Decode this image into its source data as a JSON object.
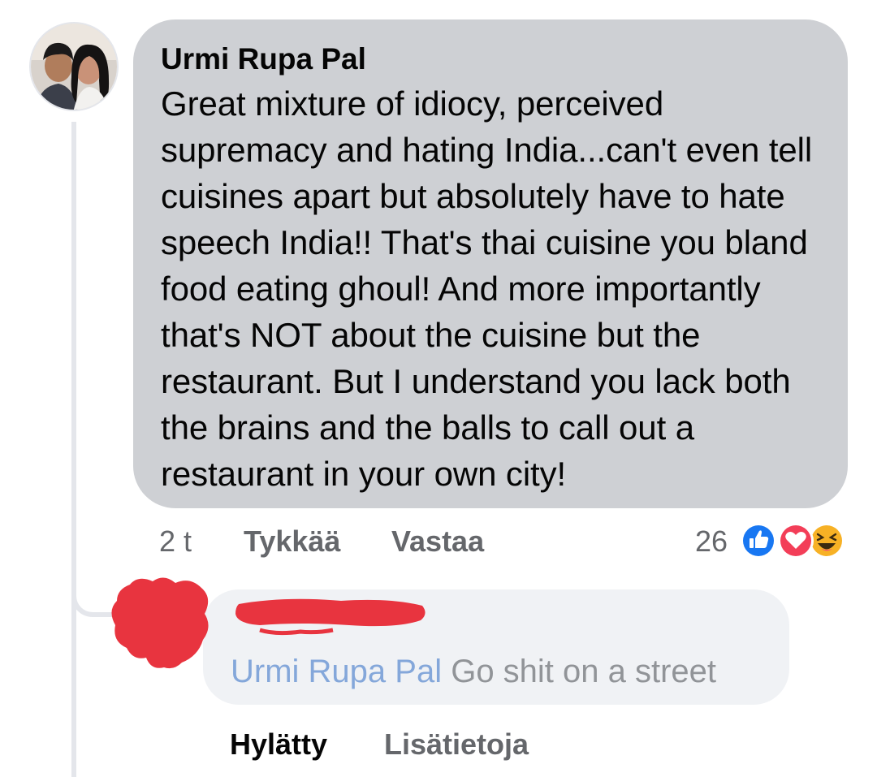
{
  "comment": {
    "author": "Urmi Rupa Pal",
    "text": "Great mixture of idiocy, perceived supremacy and hating India...can't even tell cuisines apart but absolutely have to hate speech India!! That's thai cuisine you bland food eating ghoul! And more importantly that's NOT about the cuisine but the restaurant. But I understand you lack both the brains and the balls to call out a restaurant in your own city!",
    "time": "2 t",
    "like_label": "Tykkää",
    "reply_label": "Vastaa",
    "reaction_count": "26",
    "reaction_icons": [
      "like-icon",
      "love-icon",
      "haha-icon"
    ]
  },
  "reply": {
    "mention": "Urmi Rupa Pal",
    "text": "Go shit on a street",
    "status_label": "Hylätty",
    "more_info_label": "Lisätietoja"
  },
  "colors": {
    "comment_bubble": "#ced0d4",
    "reply_bubble": "#f0f2f5",
    "mention": "#7ba1d8",
    "secondary_text": "#65676b",
    "like_blue": "#1877f2",
    "love_red": "#f33e58",
    "haha_yellow": "#f7b125",
    "redaction_red": "#e8343f"
  }
}
